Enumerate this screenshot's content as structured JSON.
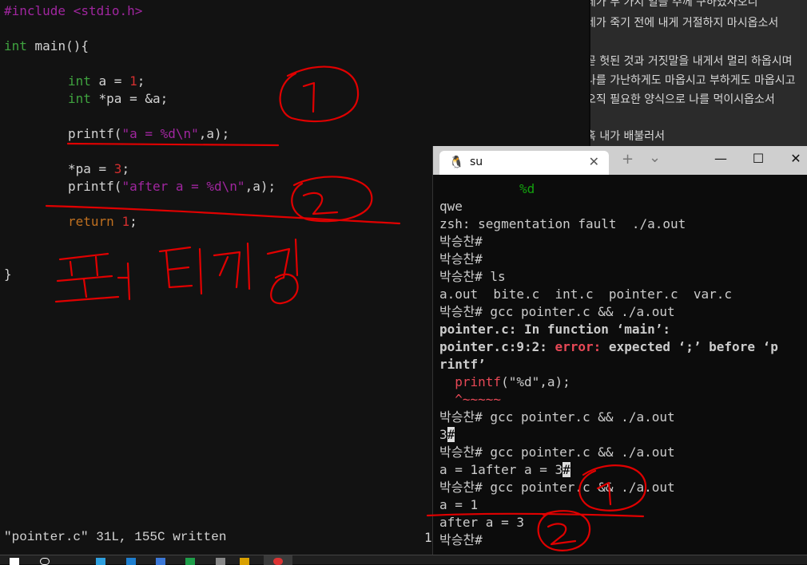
{
  "editor": {
    "lines": {
      "l1": "#include <stdio.h>",
      "l2a": "int",
      " l2b": "",
      "l2b": " main(){",
      "l3a": "int",
      " l3b": "",
      "l3b": " a = ",
      "l3c": "1",
      "l3d": ";",
      "l4a": "int",
      "l4b": " *pa = &a;",
      "l5a": "printf(",
      "l5b": "\"a = %d\\n\"",
      "l5c": ",a);",
      "l6a": "*pa = ",
      "l6b": "3",
      "l6c": ";",
      "l7a": "printf(",
      "l7b": "\"after a = %d\\n\"",
      "l7c": ",a);",
      "l8a": "return",
      "l8b": " ",
      "l8c": "1",
      "l8d": ";",
      "l9": "}"
    },
    "status": "\"pointer.c\" 31L, 155C written",
    "status_right": "1"
  },
  "background_text": [
    "네가 두 가지 일을 주께 구하였사오니",
    "네가 죽기 전에 내게 거절하지 마시옵소서",
    "곧 헛된 것과 거짓말을 내게서 멀리 하옵시며",
    "나를 가난하게도 마옵시고 부하게도 마옵시고",
    "오직 필요한 양식으로 나를 먹이시옵소서",
    "혹 내가 배불러서"
  ],
  "terminal": {
    "tab_title": "su",
    "tab_icon": "linux-penguin-icon",
    "new_tab": "+",
    "dropdown": "⌄",
    "minimize": "—",
    "maximize": "☐",
    "close": "✕",
    "tab_close": "✕",
    "lines": {
      "t1": "%d",
      "t2": "qwe",
      "t3": "zsh: segmentation fault  ./a.out",
      "t4": "박승찬#",
      "t5": "박승찬#",
      "t6": "박승찬# ls",
      "t7": "a.out  bite.c  int.c  pointer.c  var.c",
      "t8": "박승찬# gcc pointer.c && ./a.out",
      "t9": "pointer.c: In function ‘main’:",
      "t10a": "pointer.c:9:2: ",
      "t10b": "error:",
      "t10c": " expected ‘;’ before ‘p",
      "t11": "rintf’",
      "t12a": "  ",
      "t12b": "printf",
      "t12c": "(\"%d\",a);",
      "t13": "  ^~~~~~",
      "t14": "박승찬# gcc pointer.c && ./a.out",
      "t15a": "3",
      "t15b": "#",
      "t16": "박승찬# gcc pointer.c && ./a.out",
      "t17a": "a = 1after a = 3",
      "t17b": "#",
      "t18": "박승찬# gcc pointer.c && ./a.out",
      "t19": "a = 1",
      "t20": "after a = 3",
      "t21": "박승찬#"
    }
  },
  "annotations": {
    "circle1": "1",
    "circle2": "2",
    "handwriting": "포인터지정",
    "term_circle1": "1",
    "term_circle2": "2"
  },
  "colors": {
    "ink": "#e00000",
    "keyword": "#3fa33f",
    "string": "#a0269f",
    "number": "#d32f2f",
    "error": "#e74856"
  }
}
